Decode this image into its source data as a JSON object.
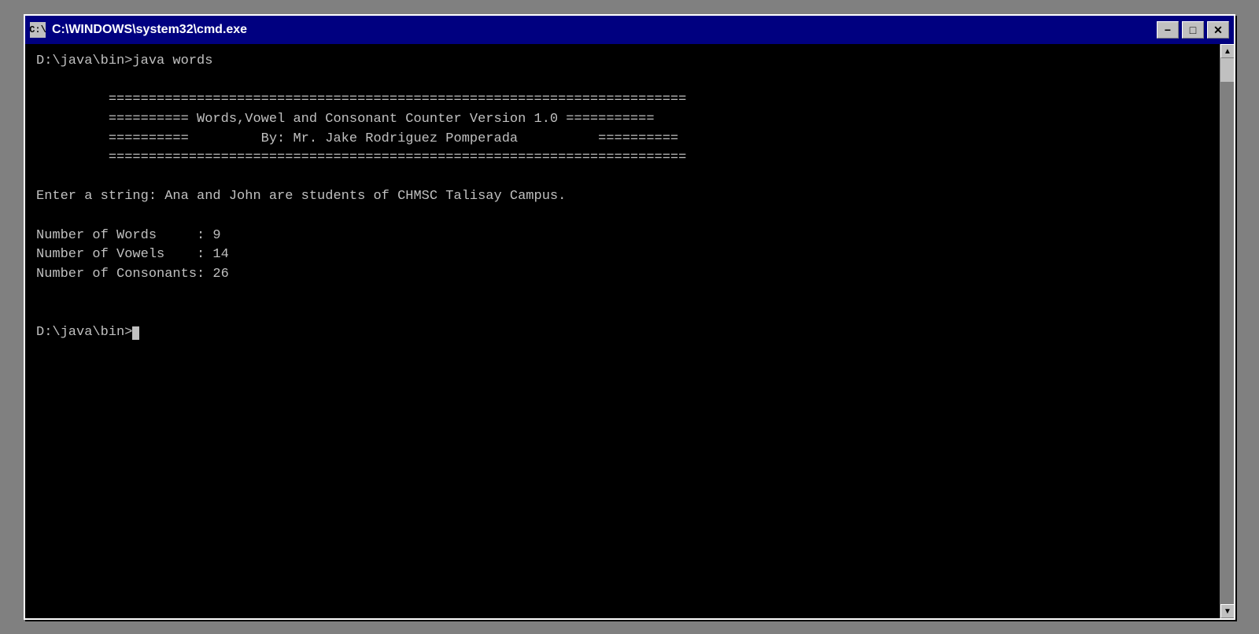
{
  "window": {
    "title": "C:\\WINDOWS\\system32\\cmd.exe",
    "icon_label": "C:\\",
    "minimize_label": "−",
    "maximize_label": "□",
    "close_label": "✕"
  },
  "terminal": {
    "line1": "D:\\java\\bin>java words",
    "line2": "",
    "header1": "         ========================================================================",
    "header2": "         ========== Words,Vowel and Consonant Counter Version 1.0 ===========",
    "header3": "         ==========         By: Mr. Jake Rodriguez Pomperada          ==========",
    "header4": "         ========================================================================",
    "line3": "",
    "input_line": "Enter a string: Ana and John are students of CHMSC Talisay Campus.",
    "line4": "",
    "words_line": "Number of Words     : 9",
    "vowels_line": "Number of Vowels    : 14",
    "consonants_line": "Number of Consonants: 26",
    "line5": "",
    "line6": "",
    "prompt_line": "D:\\java\\bin>"
  }
}
